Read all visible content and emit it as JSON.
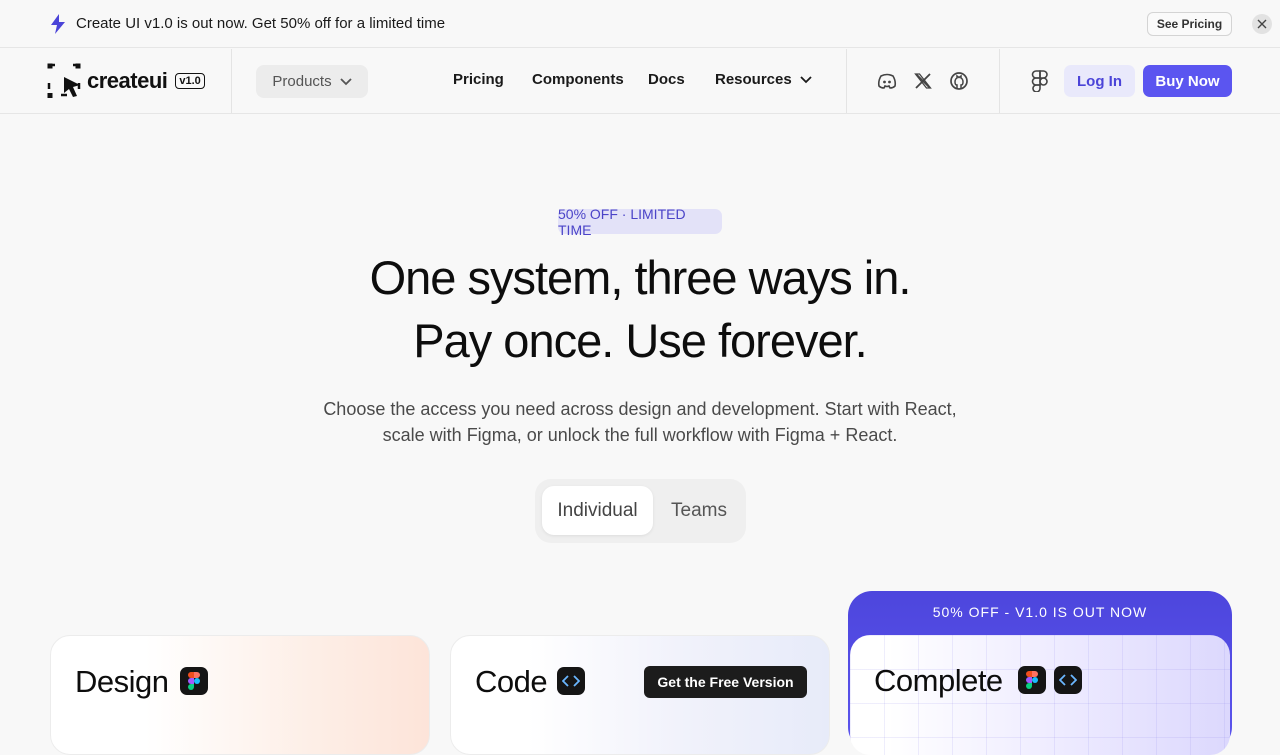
{
  "announcement": {
    "message": "Create UI v1.0 is out now. Get 50% off for a limited time",
    "cta_label": "See Pricing",
    "icon": "lightning-icon",
    "accent": "#4b44d8"
  },
  "nav": {
    "logo_text": "createui",
    "version": "v1.0",
    "products_label": "Products",
    "links": [
      "Pricing",
      "Components",
      "Docs",
      "Resources"
    ],
    "social_icons": [
      "discord-icon",
      "x-icon",
      "github-icon"
    ],
    "login_label": "Log In",
    "buy_label": "Buy Now",
    "brand_color": "#5b55f0"
  },
  "hero": {
    "badge": "50% OFF · LIMITED TIME",
    "title_line1": "One system, three ways in.",
    "title_line2": "Pay once. Use forever.",
    "subtitle_line1": "Choose the access you need across design and development. Start with React,",
    "subtitle_line2": "scale with Figma, or unlock the full workflow with Figma + React.",
    "toggle": [
      "Individual",
      "Teams"
    ],
    "toggle_selected": "Individual"
  },
  "plans": {
    "design": {
      "title": "Design"
    },
    "code": {
      "title": "Code",
      "cta": "Get the Free Version"
    },
    "complete": {
      "title": "Complete",
      "promo": "50% OFF - V1.0 IS OUT NOW"
    }
  }
}
